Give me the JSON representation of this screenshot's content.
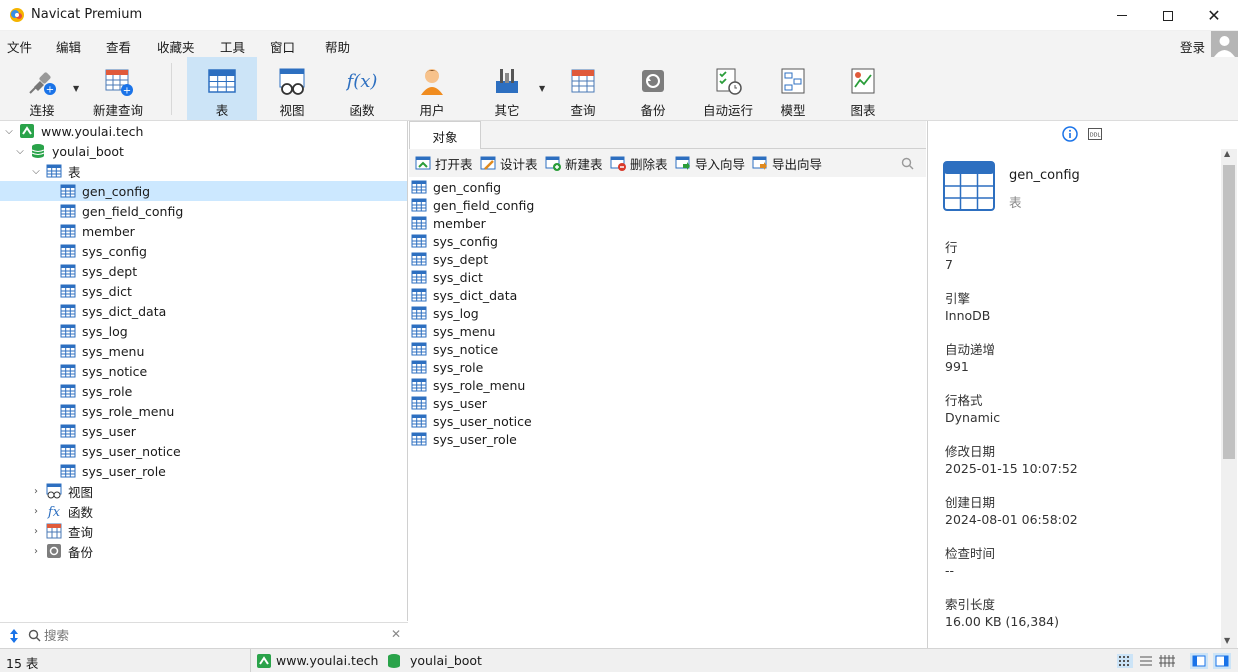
{
  "window": {
    "title": "Navicat Premium"
  },
  "menu": {
    "items": [
      "文件",
      "编辑",
      "查看",
      "收藏夹",
      "工具",
      "窗口",
      "帮助"
    ],
    "login": "登录"
  },
  "toolbar": {
    "items": [
      {
        "label": "连接",
        "icon": "plug-icon"
      },
      {
        "label": "新建查询",
        "icon": "new-query-icon"
      },
      {
        "label": "表",
        "icon": "table-icon"
      },
      {
        "label": "视图",
        "icon": "view-icon"
      },
      {
        "label": "函数",
        "icon": "function-icon"
      },
      {
        "label": "用户",
        "icon": "user-icon"
      },
      {
        "label": "其它",
        "icon": "tools-icon"
      },
      {
        "label": "查询",
        "icon": "query-icon"
      },
      {
        "label": "备份",
        "icon": "backup-icon"
      },
      {
        "label": "自动运行",
        "icon": "schedule-icon"
      },
      {
        "label": "模型",
        "icon": "model-icon"
      },
      {
        "label": "图表",
        "icon": "chart-icon"
      }
    ]
  },
  "tree": {
    "connection": "www.youlai.tech",
    "database": "youlai_boot",
    "tables_label": "表",
    "tables": [
      "gen_config",
      "gen_field_config",
      "member",
      "sys_config",
      "sys_dept",
      "sys_dict",
      "sys_dict_data",
      "sys_log",
      "sys_menu",
      "sys_notice",
      "sys_role",
      "sys_role_menu",
      "sys_user",
      "sys_user_notice",
      "sys_user_role"
    ],
    "selected": "gen_config",
    "groups": [
      "视图",
      "函数",
      "查询",
      "备份"
    ],
    "search_placeholder": "搜索"
  },
  "objects": {
    "tab": "对象",
    "actions": [
      "打开表",
      "设计表",
      "新建表",
      "删除表",
      "导入向导",
      "导出向导"
    ],
    "list": [
      "gen_config",
      "gen_field_config",
      "member",
      "sys_config",
      "sys_dept",
      "sys_dict",
      "sys_dict_data",
      "sys_log",
      "sys_menu",
      "sys_notice",
      "sys_role",
      "sys_role_menu",
      "sys_user",
      "sys_user_notice",
      "sys_user_role"
    ]
  },
  "props": {
    "name": "gen_config",
    "type": "表",
    "fields": [
      {
        "label": "行",
        "value": "7"
      },
      {
        "label": "引擎",
        "value": "InnoDB"
      },
      {
        "label": "自动递增",
        "value": "991"
      },
      {
        "label": "行格式",
        "value": "Dynamic"
      },
      {
        "label": "修改日期",
        "value": "2025-01-15 10:07:52"
      },
      {
        "label": "创建日期",
        "value": "2024-08-01 06:58:02"
      },
      {
        "label": "检查时间",
        "value": "--"
      },
      {
        "label": "索引长度",
        "value": "16.00 KB (16,384)"
      }
    ]
  },
  "status": {
    "count": "15 表",
    "connection": "www.youlai.tech",
    "database": "youlai_boot"
  },
  "colors": {
    "accent": "#0a64c8",
    "selection": "#cce8ff",
    "toolbar_bg": "#f3f3f3"
  }
}
